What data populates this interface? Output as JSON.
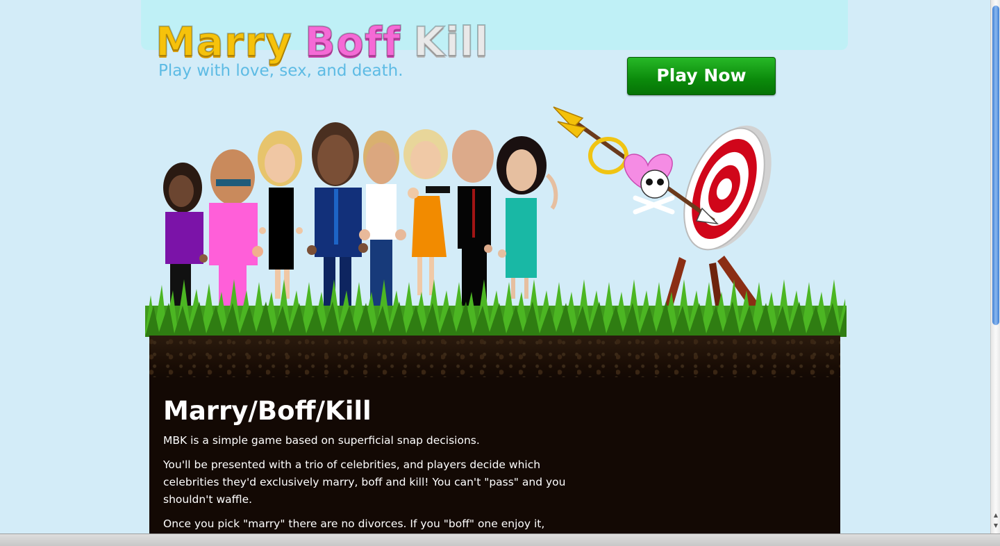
{
  "logo": {
    "marry": "Marry",
    "boff": "Boff",
    "kill": "Kill"
  },
  "tagline": "Play with love, sex, and death.",
  "play_button": "Play Now",
  "content": {
    "title": "Marry/Boff/Kill",
    "paragraphs": [
      "MBK is a simple game based on superficial snap decisions.",
      "You'll be presented with a trio of celebrities, and players decide which celebrities they'd exclusively marry, boff and kill! You can't \"pass\" and you shouldn't waffle.",
      "Once you pick \"marry\" there are no divorces. If you \"boff\" one enjoy it,"
    ]
  },
  "colors": {
    "background": "#d3ecf8",
    "marry": "#f6c20b",
    "boff": "#f56ad6",
    "kill": "#e9e9e9",
    "tagline": "#5dbbe4",
    "play_button": "#0b8a0b",
    "dirt": "#130904"
  },
  "icons": [
    "wedding-ring-icon",
    "heart-icon",
    "skull-icon",
    "arrow-icon",
    "target-icon"
  ]
}
